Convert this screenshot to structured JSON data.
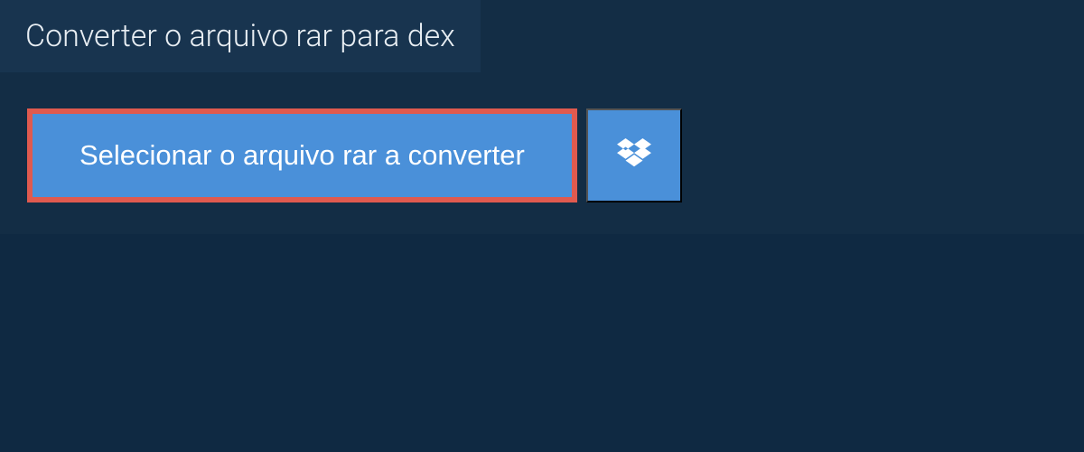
{
  "header": {
    "title": "Converter o arquivo rar para dex"
  },
  "actions": {
    "select_file_label": "Selecionar o arquivo rar a converter",
    "dropbox_icon_name": "dropbox-icon"
  }
}
